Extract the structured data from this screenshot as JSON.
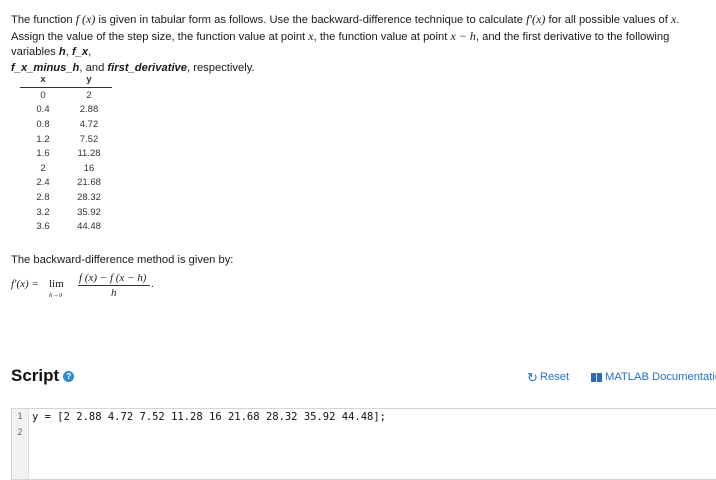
{
  "problem": {
    "p1": "The function ",
    "fx": "f (x)",
    "p2": " is given in tabular form as follows. Use the backward-difference technique to calculate ",
    "fpx": "f′(x)",
    "p3": " for all possible values of ",
    "x1": "x",
    "p4": ". Assign the value of the step size, the function value at point ",
    "x2": "x",
    "p5": ", the function value at point ",
    "xmh": "x − h",
    "p6": ", and the first derivative to the following variables ",
    "v1": "h",
    "c1": ", ",
    "v2": "f_x",
    "c2": ",",
    "v3": "f_x_minus_h",
    "c3": ", and ",
    "v4": "first_derivative",
    "end": ", respectively."
  },
  "table": {
    "headers": [
      "x",
      "y"
    ],
    "rows": [
      [
        "0",
        "2"
      ],
      [
        "0.4",
        "2.88"
      ],
      [
        "0.8",
        "4.72"
      ],
      [
        "1.2",
        "7.52"
      ],
      [
        "1.6",
        "11.28"
      ],
      [
        "2",
        "16"
      ],
      [
        "2.4",
        "21.68"
      ],
      [
        "2.8",
        "28.32"
      ],
      [
        "3.2",
        "35.92"
      ],
      [
        "3.6",
        "44.48"
      ]
    ]
  },
  "method_text": "The backward-difference method is given by:",
  "formula": {
    "lhs": "f′(x) =",
    "lim": "lim",
    "lim_sub": "h→0",
    "numerator": "f (x) − f (x − h)",
    "denominator": "h",
    "period": "."
  },
  "script": {
    "title": "Script",
    "help_icon": "?",
    "reset_label": "Reset",
    "docs_label": "MATLAB Documentation"
  },
  "editor": {
    "line_numbers": [
      "1",
      "2"
    ],
    "lines": [
      "y = [2 2.88 4.72 7.52 11.28 16 21.68 28.32 35.92 44.48];",
      ""
    ]
  }
}
